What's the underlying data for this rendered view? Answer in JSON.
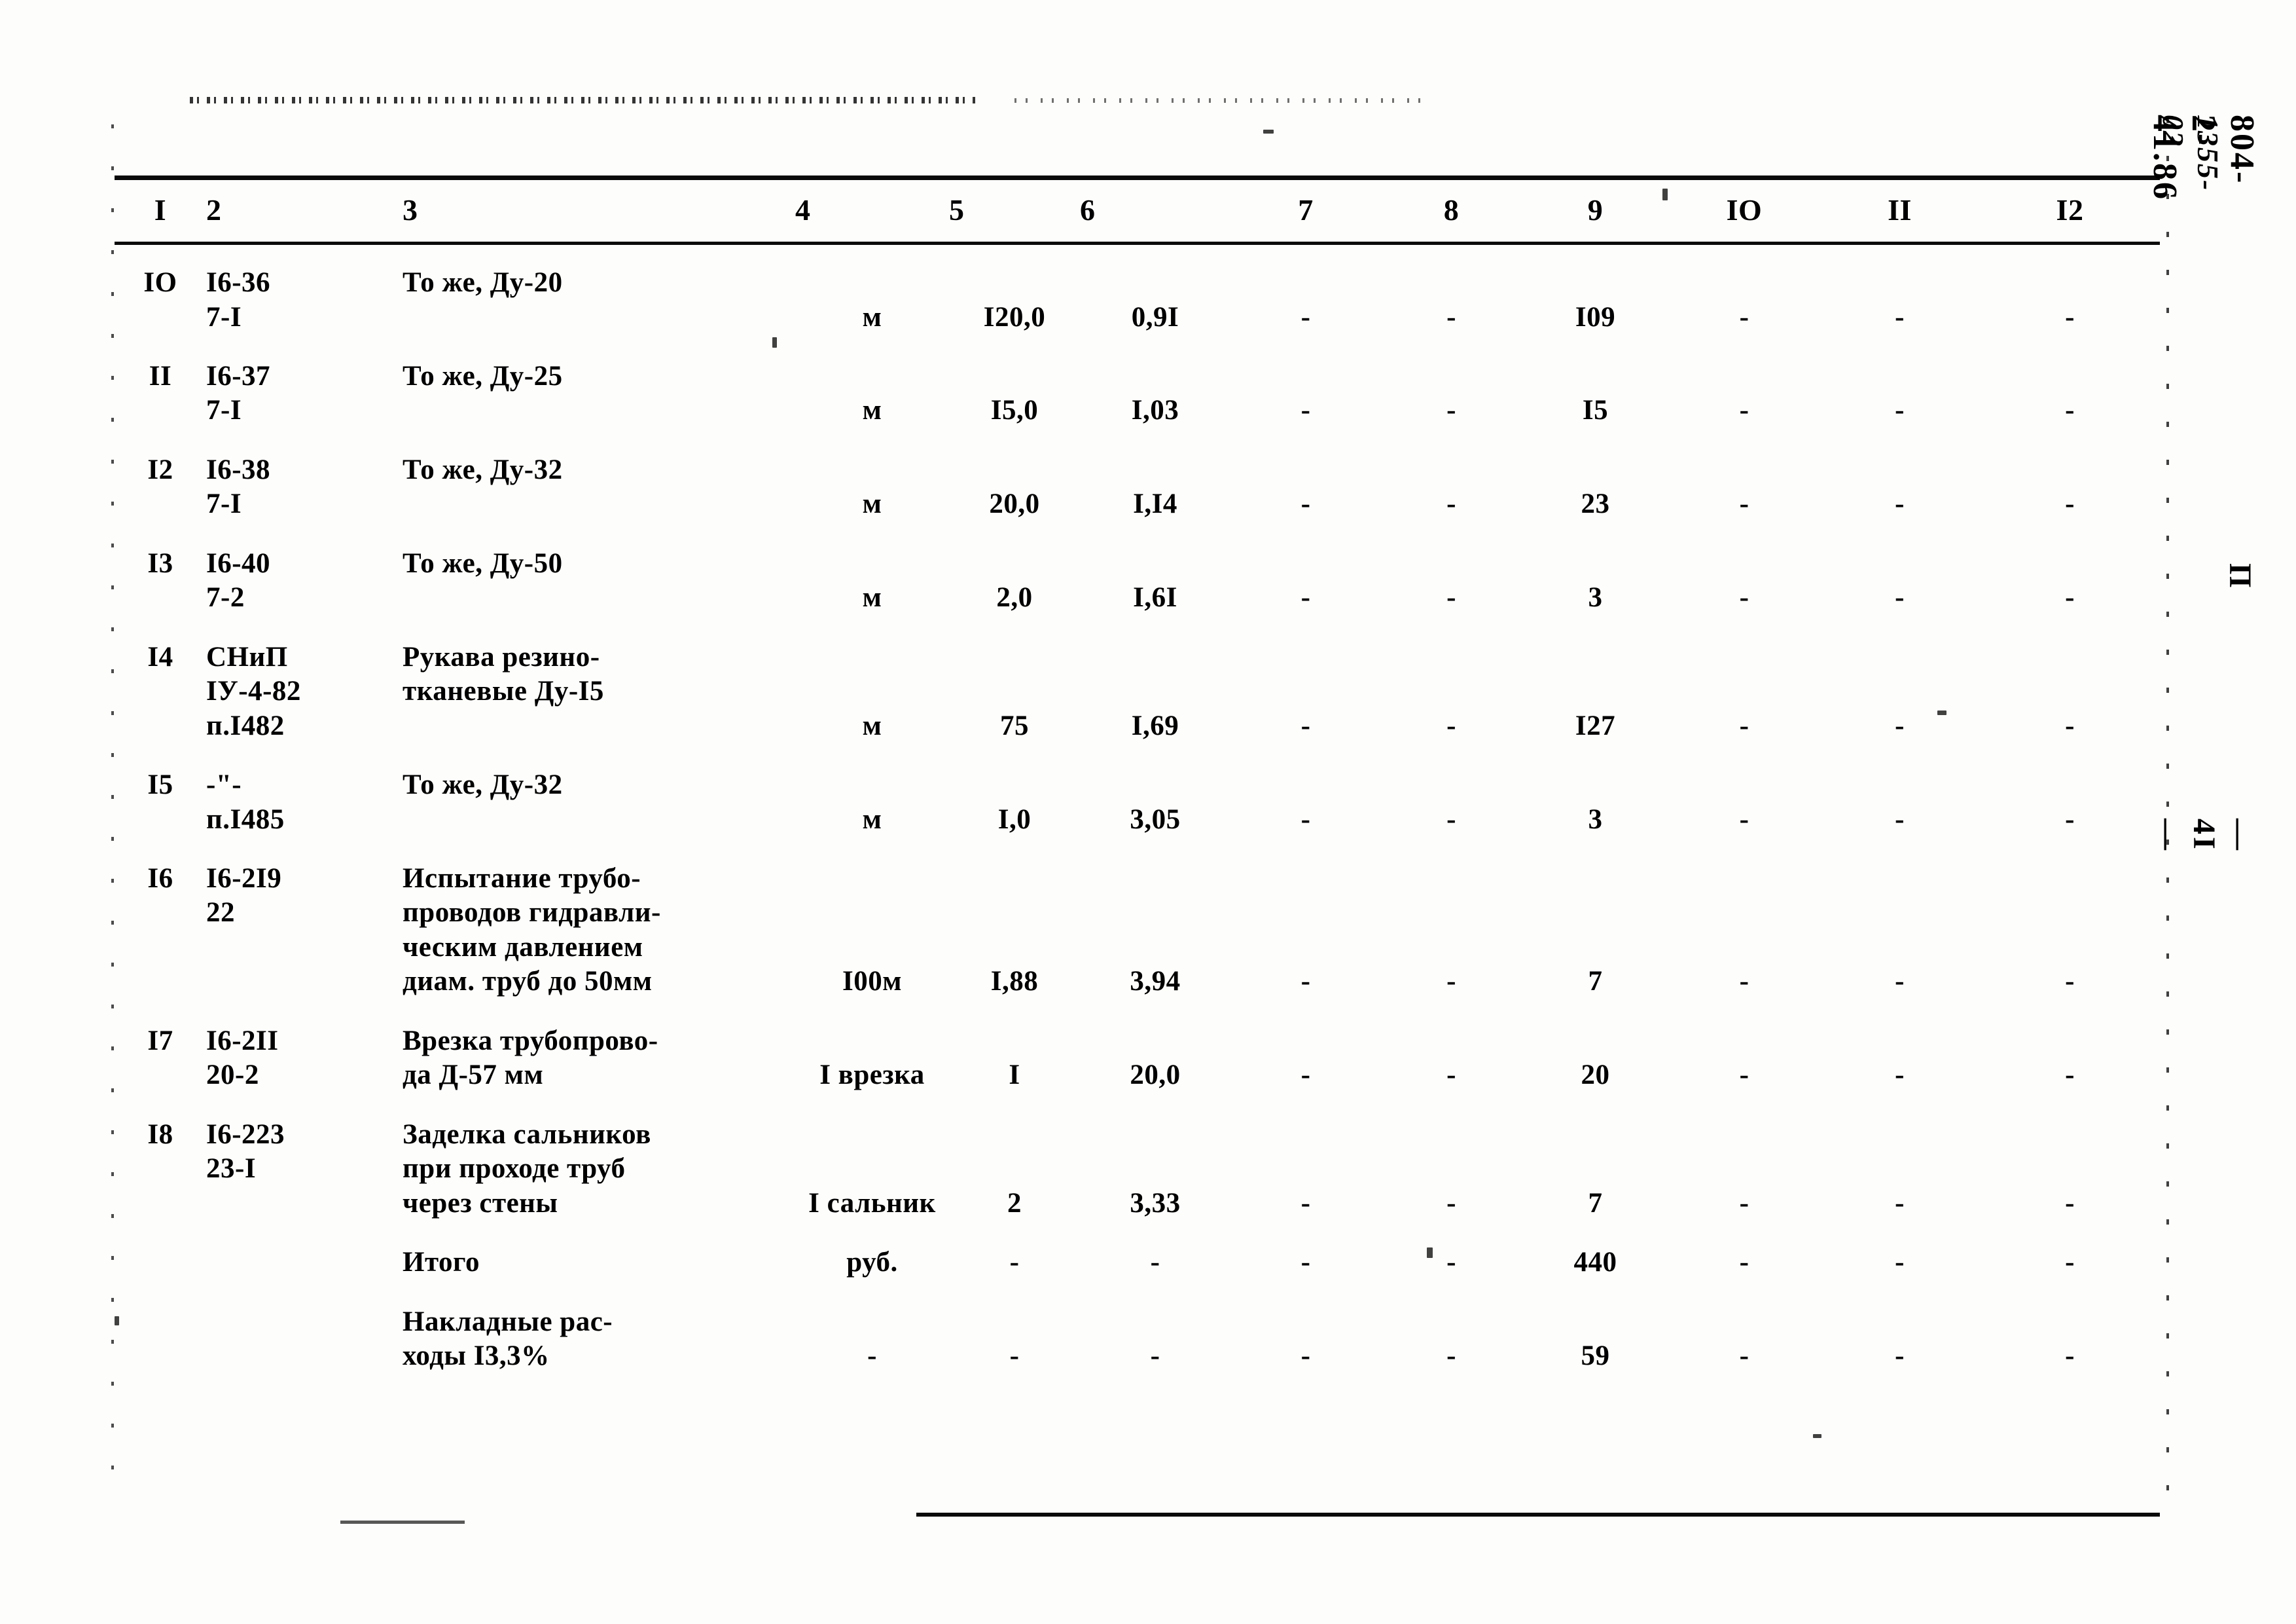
{
  "document": {
    "handwritten_code": "1355-02",
    "doc_code": "804-2-41.86",
    "margin_mark": "П",
    "page_marker": "— 4I —"
  },
  "table": {
    "column_headers": [
      "I",
      "2",
      "3",
      "4",
      "5",
      "6",
      "7",
      "8",
      "9",
      "IO",
      "II",
      "I2"
    ],
    "rows": [
      {
        "num": "IO",
        "code": "I6-36\n7-I",
        "desc": "То же, Ду-20",
        "unit": "м",
        "c5": "I20,0",
        "c6": "0,9I",
        "c7": "-",
        "c8": "-",
        "c9": "I09",
        "c10": "-",
        "c11": "-",
        "c12": "-"
      },
      {
        "num": "II",
        "code": "I6-37\n7-I",
        "desc": "То же, Ду-25",
        "unit": "м",
        "c5": "I5,0",
        "c6": "I,03",
        "c7": "-",
        "c8": "-",
        "c9": "I5",
        "c10": "-",
        "c11": "-",
        "c12": "-"
      },
      {
        "num": "I2",
        "code": "I6-38\n7-I",
        "desc": "То же, Ду-32",
        "unit": "м",
        "c5": "20,0",
        "c6": "I,I4",
        "c7": "-",
        "c8": "-",
        "c9": "23",
        "c10": "-",
        "c11": "-",
        "c12": "-"
      },
      {
        "num": "I3",
        "code": "I6-40\n7-2",
        "desc": "То же, Ду-50",
        "unit": "м",
        "c5": "2,0",
        "c6": "I,6I",
        "c7": "-",
        "c8": "-",
        "c9": "3",
        "c10": "-",
        "c11": "-",
        "c12": "-"
      },
      {
        "num": "I4",
        "code": "СНиП\nIУ-4-82\nп.I482",
        "desc": "Рукава резино-\nтканевые Ду-I5",
        "unit": "м",
        "c5": "75",
        "c6": "I,69",
        "c7": "-",
        "c8": "-",
        "c9": "I27",
        "c10": "-",
        "c11": "-",
        "c12": "-"
      },
      {
        "num": "I5",
        "code": "-\"-\nп.I485",
        "desc": "То же, Ду-32",
        "unit": "м",
        "c5": "I,0",
        "c6": "3,05",
        "c7": "-",
        "c8": "-",
        "c9": "3",
        "c10": "-",
        "c11": "-",
        "c12": "-"
      },
      {
        "num": "I6",
        "code": "I6-2I9\n22",
        "desc": "Испытание трубо-\nпроводов гидравли-\nческим давлением\nдиам. труб до 50мм",
        "unit": "I00м",
        "c5": "I,88",
        "c6": "3,94",
        "c7": "-",
        "c8": "-",
        "c9": "7",
        "c10": "-",
        "c11": "-",
        "c12": "-"
      },
      {
        "num": "I7",
        "code": "I6-2II\n20-2",
        "desc": "Врезка трубопрово-\nда Д-57 мм",
        "unit": "I\nврезка",
        "c5": "I",
        "c6": "20,0",
        "c7": "-",
        "c8": "-",
        "c9": "20",
        "c10": "-",
        "c11": "-",
        "c12": "-"
      },
      {
        "num": "I8",
        "code": "I6-223\n23-I",
        "desc": "Заделка сальников\nпри проходе труб\nчерез стены",
        "unit": "I\nсальник",
        "c5": "2",
        "c6": "3,33",
        "c7": "-",
        "c8": "-",
        "c9": "7",
        "c10": "-",
        "c11": "-",
        "c12": "-"
      },
      {
        "num": "",
        "code": "",
        "desc": "Итого",
        "unit": "руб.",
        "c5": "-",
        "c6": "-",
        "c7": "-",
        "c8": "-",
        "c9": "440",
        "c10": "-",
        "c11": "-",
        "c12": "-"
      },
      {
        "num": "",
        "code": "",
        "desc": "Накладные рас-\nходы I3,3%",
        "unit": "-",
        "c5": "-",
        "c6": "-",
        "c7": "-",
        "c8": "-",
        "c9": "59",
        "c10": "-",
        "c11": "-",
        "c12": "-"
      }
    ]
  }
}
